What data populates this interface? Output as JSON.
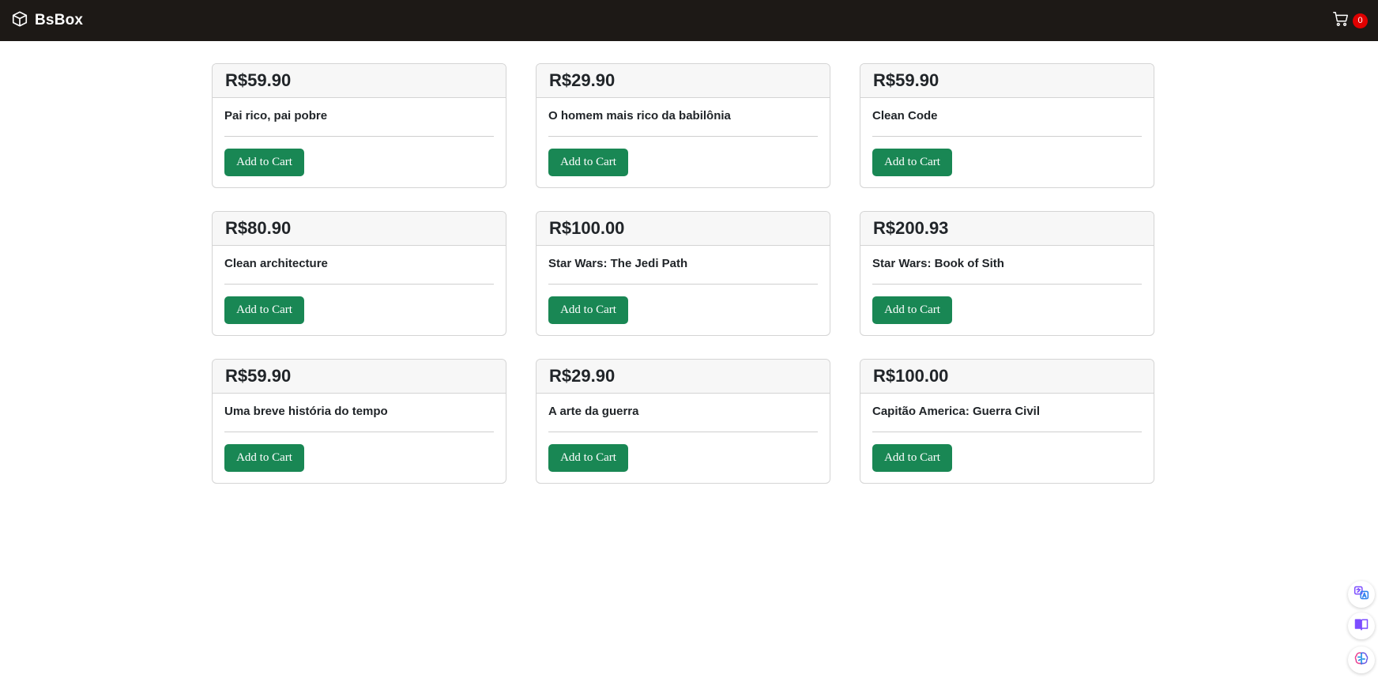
{
  "navbar": {
    "brand_name": "BsBox",
    "brand_icon": "box-icon",
    "cart_icon": "cart-icon",
    "cart_count": "0",
    "background_color": "#1d1916",
    "badge_color": "#e00000"
  },
  "products": [
    {
      "price": "R$59.90",
      "title": "Pai rico, pai pobre",
      "button_label": "Add to Cart"
    },
    {
      "price": "R$29.90",
      "title": "O homem mais rico da babilônia",
      "button_label": "Add to Cart"
    },
    {
      "price": "R$59.90",
      "title": "Clean Code",
      "button_label": "Add to Cart"
    },
    {
      "price": "R$80.90",
      "title": "Clean architecture",
      "button_label": "Add to Cart"
    },
    {
      "price": "R$100.00",
      "title": "Star Wars: The Jedi Path",
      "button_label": "Add to Cart"
    },
    {
      "price": "R$200.93",
      "title": "Star Wars: Book of Sith",
      "button_label": "Add to Cart"
    },
    {
      "price": "R$59.90",
      "title": "Uma breve história do tempo",
      "button_label": "Add to Cart"
    },
    {
      "price": "R$29.90",
      "title": "A arte da guerra",
      "button_label": "Add to Cart"
    },
    {
      "price": "R$100.00",
      "title": "Capitão America: Guerra Civil",
      "button_label": "Add to Cart"
    }
  ],
  "button_color": "#198754",
  "side_tools": [
    "translate-icon",
    "book-reader-icon",
    "brain-icon"
  ]
}
